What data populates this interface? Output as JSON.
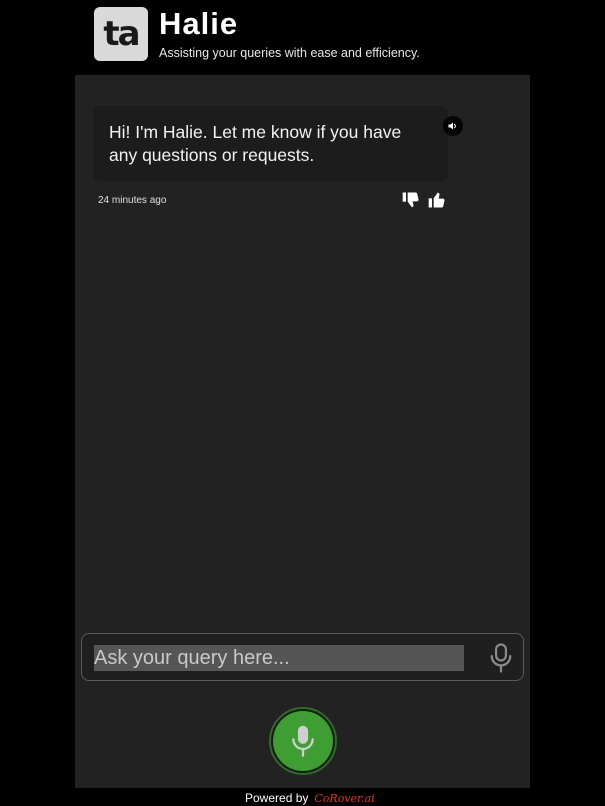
{
  "header": {
    "logo_text": "ta",
    "title": "Halie",
    "subtitle": "Assisting your queries with ease and efficiency."
  },
  "chat": {
    "messages": [
      {
        "text": "Hi! I'm Halie. Let me know if you have any questions or requests.",
        "timestamp": "24 minutes ago"
      }
    ]
  },
  "icons": {
    "speaker": "speaker-icon",
    "thumbs_down": "thumbs-down-icon",
    "thumbs_up": "thumbs-up-icon",
    "mic": "microphone-icon"
  },
  "input": {
    "placeholder": "Ask your query here...",
    "value": ""
  },
  "footer": {
    "powered_by": "Powered by",
    "brand": "CoRover.ai"
  },
  "colors": {
    "background": "#000000",
    "panel": "#222222",
    "bubble": "#1c1c1c",
    "mic_button": "#3e9d33",
    "brand": "#e0332a"
  }
}
